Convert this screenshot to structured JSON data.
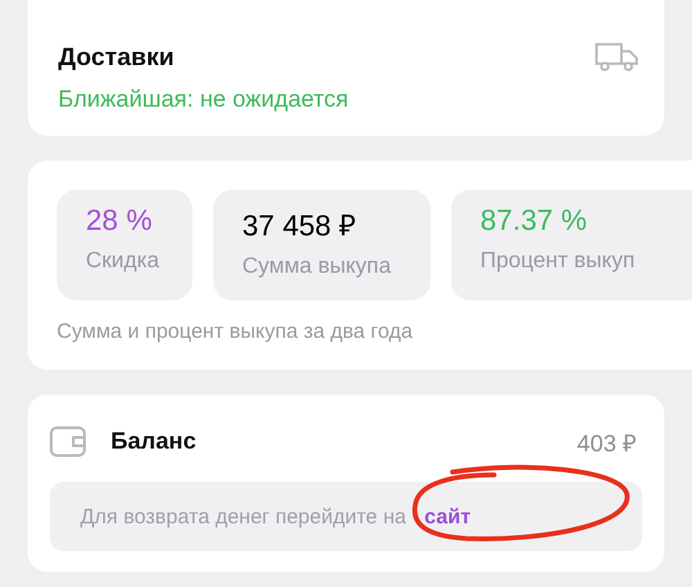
{
  "deliveries": {
    "title": "Доставки",
    "nearest": "Ближайшая: не ожидается"
  },
  "stats": {
    "tiles": [
      {
        "value": "28 %",
        "label": "Скидка",
        "color": "#a54fd6"
      },
      {
        "value": "37 458 ₽",
        "label": "Сумма выкупа",
        "color": "#000000"
      },
      {
        "value": "87.37 %",
        "label": "Процент выкуп",
        "color": "#3fba5c"
      }
    ],
    "caption": "Сумма и процент выкупа за два года"
  },
  "balance": {
    "title": "Баланс",
    "amount": "403 ₽",
    "note": "Для возврата денег перейдите на ",
    "link": "сайт"
  }
}
